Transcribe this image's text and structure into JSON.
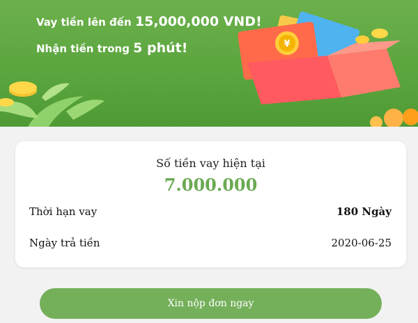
{
  "banner": {
    "line1_prefix": "Vay tiền lên đến ",
    "line1_amount": "15,000,000 VND!",
    "line2_prefix": "Nhận tiền trong ",
    "line2_time": "5 phút!",
    "coin_symbol": "¥",
    "icons": [
      "red-envelope-icon",
      "gift-box-icon",
      "coin-icon",
      "leaf-icon"
    ]
  },
  "loan": {
    "title": "Số tiền vay hiện tại",
    "amount": "7.000.000",
    "term_label": "Thời hạn vay",
    "term_value": "180 Ngày",
    "due_label": "Ngày trả tiền",
    "due_value": "2020-06-25"
  },
  "actions": {
    "submit_label": "Xin nộp đơn ngay"
  },
  "colors": {
    "banner_green": "#5aa53d",
    "amount_green": "#6aaa52",
    "button_green": "#74b05a",
    "background": "#f2f2f2"
  }
}
